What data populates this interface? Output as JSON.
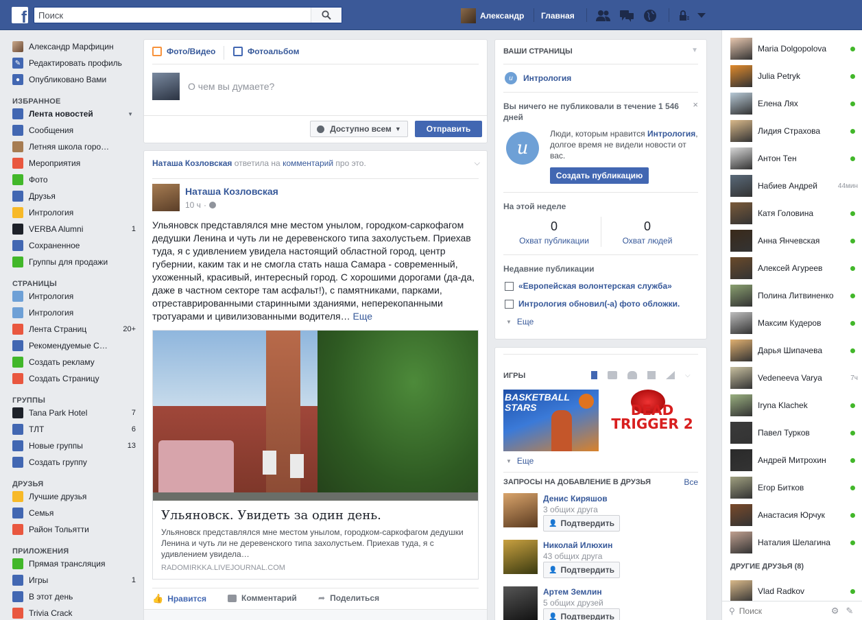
{
  "top": {
    "search_placeholder": "Поиск",
    "user_name": "Александр",
    "home": "Главная"
  },
  "left": {
    "profile": [
      {
        "label": "Александр Марфицин",
        "icon": "avatar"
      },
      {
        "label": "Редактировать профиль",
        "icon": "pencil-icon"
      },
      {
        "label": "Опубликовано Вами",
        "icon": "person-icon"
      }
    ],
    "favorites_title": "ИЗБРАННОЕ",
    "favorites": [
      {
        "label": "Лента новостей",
        "count": "",
        "icon": "news-feed-icon",
        "color": "#4267b2"
      },
      {
        "label": "Сообщения",
        "count": "",
        "icon": "messages-icon",
        "color": "#4267b2"
      },
      {
        "label": "Летняя школа горо…",
        "count": "",
        "icon": "pin-icon",
        "color": "#a67c52"
      },
      {
        "label": "Мероприятия",
        "count": "",
        "icon": "calendar-icon",
        "color": "#e9573f"
      },
      {
        "label": "Фото",
        "count": "",
        "icon": "photo-icon",
        "color": "#42b72a"
      },
      {
        "label": "Друзья",
        "count": "",
        "icon": "friends-icon",
        "color": "#4267b2"
      },
      {
        "label": "Интрология",
        "count": "",
        "icon": "bulb-icon",
        "color": "#f7b928"
      },
      {
        "label": "VERBA Alumni",
        "count": "1",
        "icon": "graduation-icon",
        "color": "#1d2129"
      },
      {
        "label": "Сохраненное",
        "count": "",
        "icon": "bookmark-icon",
        "color": "#4267b2"
      },
      {
        "label": "Группы для продажи",
        "count": "",
        "icon": "shop-icon",
        "color": "#42b72a"
      }
    ],
    "pages_title": "СТРАНИЦЫ",
    "pages": [
      {
        "label": "Интрология",
        "count": "",
        "icon": "introl-icon",
        "color": "#6ea0d6"
      },
      {
        "label": "Интрология",
        "count": "",
        "icon": "introl-icon",
        "color": "#6ea0d6"
      },
      {
        "label": "Лента Страниц",
        "count": "20+",
        "icon": "flag-icon",
        "color": "#e9573f"
      },
      {
        "label": "Рекомендуемые С…",
        "count": "",
        "icon": "like-icon",
        "color": "#4267b2"
      },
      {
        "label": "Создать рекламу",
        "count": "",
        "icon": "ad-icon",
        "color": "#42b72a"
      },
      {
        "label": "Создать Страницу",
        "count": "",
        "icon": "create-page-icon",
        "color": "#e9573f"
      }
    ],
    "groups_title": "ГРУППЫ",
    "groups": [
      {
        "label": "Tana Park Hotel",
        "count": "7",
        "icon": "camera-icon",
        "color": "#1d2129"
      },
      {
        "label": "ТЛТ",
        "count": "6",
        "icon": "group-icon",
        "color": "#4267b2"
      },
      {
        "label": "Новые группы",
        "count": "13",
        "icon": "new-groups-icon",
        "color": "#4267b2"
      },
      {
        "label": "Создать группу",
        "count": "",
        "icon": "plus-icon",
        "color": "#4267b2"
      }
    ],
    "friends_title": "ДРУЗЬЯ",
    "friends": [
      {
        "label": "Лучшие друзья",
        "count": "",
        "icon": "star-icon",
        "color": "#f7b928"
      },
      {
        "label": "Семья",
        "count": "",
        "icon": "family-icon",
        "color": "#4267b2"
      },
      {
        "label": "Район Тольятти",
        "count": "",
        "icon": "location-icon",
        "color": "#e9573f"
      }
    ],
    "apps_title": "ПРИЛОЖЕНИЯ",
    "apps": [
      {
        "label": "Прямая трансляция",
        "count": "",
        "icon": "live-icon",
        "color": "#42b72a"
      },
      {
        "label": "Игры",
        "count": "1",
        "icon": "games-icon",
        "color": "#4267b2"
      },
      {
        "label": "В этот день",
        "count": "",
        "icon": "clock-icon",
        "color": "#4267b2"
      },
      {
        "label": "Trivia Crack",
        "count": "",
        "icon": "trivia-icon",
        "color": "#e9573f"
      }
    ]
  },
  "composer": {
    "tab_photo": "Фото/Видео",
    "tab_album": "Фотоальбом",
    "placeholder": "О чем вы думаете?",
    "privacy": "Доступно всем",
    "submit": "Отправить"
  },
  "post": {
    "story_actor": "Наташа Козловская",
    "story_verb": "ответила на",
    "story_link": "комментарий",
    "story_tail": "про это.",
    "author": "Наташа Козловская",
    "time": "10 ч",
    "text": "Ульяновск представлялся мне местом унылом, городком-саркофагом дедушки Ленина и чуть ли не деревенского типа захолустьем. Приехав туда, я с удивлением увидела настоящий областной город, центр губернии, каким так и не смогла стать наша Самара - современный, ухоженный, красивый, интересный город. С хорошими дорогами (да-да, даже в частном секторе там асфальт!), с памятниками, парками, отреставрированными старинными зданиями, неперекопанными тротуарами и цивилизованными водителя…",
    "more": "Еще",
    "link_title": "Ульяновск. Увидеть за один день.",
    "link_desc": "Ульяновск представлялся мне местом унылом, городком-саркофагом дедушки Ленина и чуть ли не деревенского типа захолустьем. Приехав туда, я с удивлением увидела…",
    "link_domain": "RADOMIRKKA.LIVEJOURNAL.COM",
    "like": "Нравится",
    "comment": "Комментарий",
    "share": "Поделиться"
  },
  "pages_panel": {
    "title": "ВАШИ СТРАНИЦЫ",
    "page_name": "Интрология",
    "notice_title": "Вы ничего не публиковали в течение 1 546 дней",
    "notice_text_1": "Люди, которым нравится",
    "notice_page": "Интрология",
    "notice_text_2": ", долгое время не видели новости от вас.",
    "create_post": "Создать публикацию",
    "week_title": "На этой неделе",
    "reach_posts_value": "0",
    "reach_posts_label": "Охват публикации",
    "reach_people_value": "0",
    "reach_people_label": "Охват людей",
    "recent_title": "Недавние публикации",
    "recent_1": "«Европейская волонтерская служба»",
    "recent_2": "Интрология обновил(-а) фото обложки.",
    "more": "Еще"
  },
  "games_panel": {
    "title": "ИГРЫ",
    "game1_title": "BASKETBALL STARS",
    "game2_title": "DEAD TRIGGER 2",
    "more": "Еще"
  },
  "requests": {
    "title": "ЗАПРОСЫ НА ДОБАВЛЕНИЕ В ДРУЗЬЯ",
    "all": "Все",
    "confirm": "Подтвердить",
    "items": [
      {
        "name": "Денис Киряшов",
        "mutual": "3 общих друга"
      },
      {
        "name": "Николай Илюхин",
        "mutual": "43 общих друга"
      },
      {
        "name": "Артем Землин",
        "mutual": "5 общих друзей"
      }
    ]
  },
  "chat": {
    "contacts": [
      {
        "name": "Maria Dolgopolova",
        "status": ""
      },
      {
        "name": "Julia Petryk",
        "status": ""
      },
      {
        "name": "Елена Лях",
        "status": ""
      },
      {
        "name": "Лидия Страхова",
        "status": ""
      },
      {
        "name": "Антон Тен",
        "status": ""
      },
      {
        "name": "Набиев Андрей",
        "status": "44мин"
      },
      {
        "name": "Катя Головина",
        "status": ""
      },
      {
        "name": "Анна Янчевская",
        "status": ""
      },
      {
        "name": "Алексей Агуреев",
        "status": ""
      },
      {
        "name": "Полина Литвиненко",
        "status": ""
      },
      {
        "name": "Максим Кудеров",
        "status": ""
      },
      {
        "name": "Дарья Шипачева",
        "status": ""
      },
      {
        "name": "Vedeneeva Varya",
        "status": "7ч"
      },
      {
        "name": "Iryna Klachek",
        "status": ""
      },
      {
        "name": "Павел Турков",
        "status": ""
      },
      {
        "name": "Андрей Митрохин",
        "status": ""
      },
      {
        "name": "Егор Битков",
        "status": ""
      },
      {
        "name": "Анастасия Юрчук",
        "status": ""
      },
      {
        "name": "Наталия Шелагина",
        "status": ""
      }
    ],
    "other_title": "ДРУГИЕ ДРУЗЬЯ (8)",
    "other": [
      {
        "name": "Vlad Radkov",
        "status": ""
      }
    ],
    "search_placeholder": "Поиск"
  }
}
